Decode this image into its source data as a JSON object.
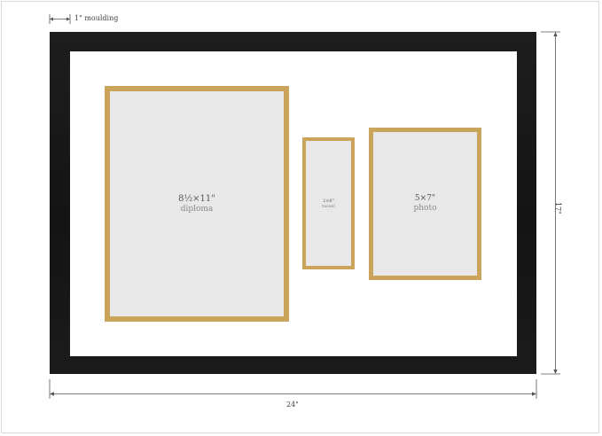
{
  "dimensions": {
    "moulding": "1\" moulding",
    "width": "24\"",
    "height": "17\""
  },
  "openings": [
    {
      "size": "8½×11\"",
      "label": "diploma"
    },
    {
      "size": "2×6\"",
      "label": "tassel"
    },
    {
      "size": "5×7\"",
      "label": "photo"
    }
  ],
  "colors": {
    "frame": "#1a1a1a",
    "mat": "#ffffff",
    "opening_border": "#c9a45a",
    "opening_fill": "#e8e8e8"
  }
}
